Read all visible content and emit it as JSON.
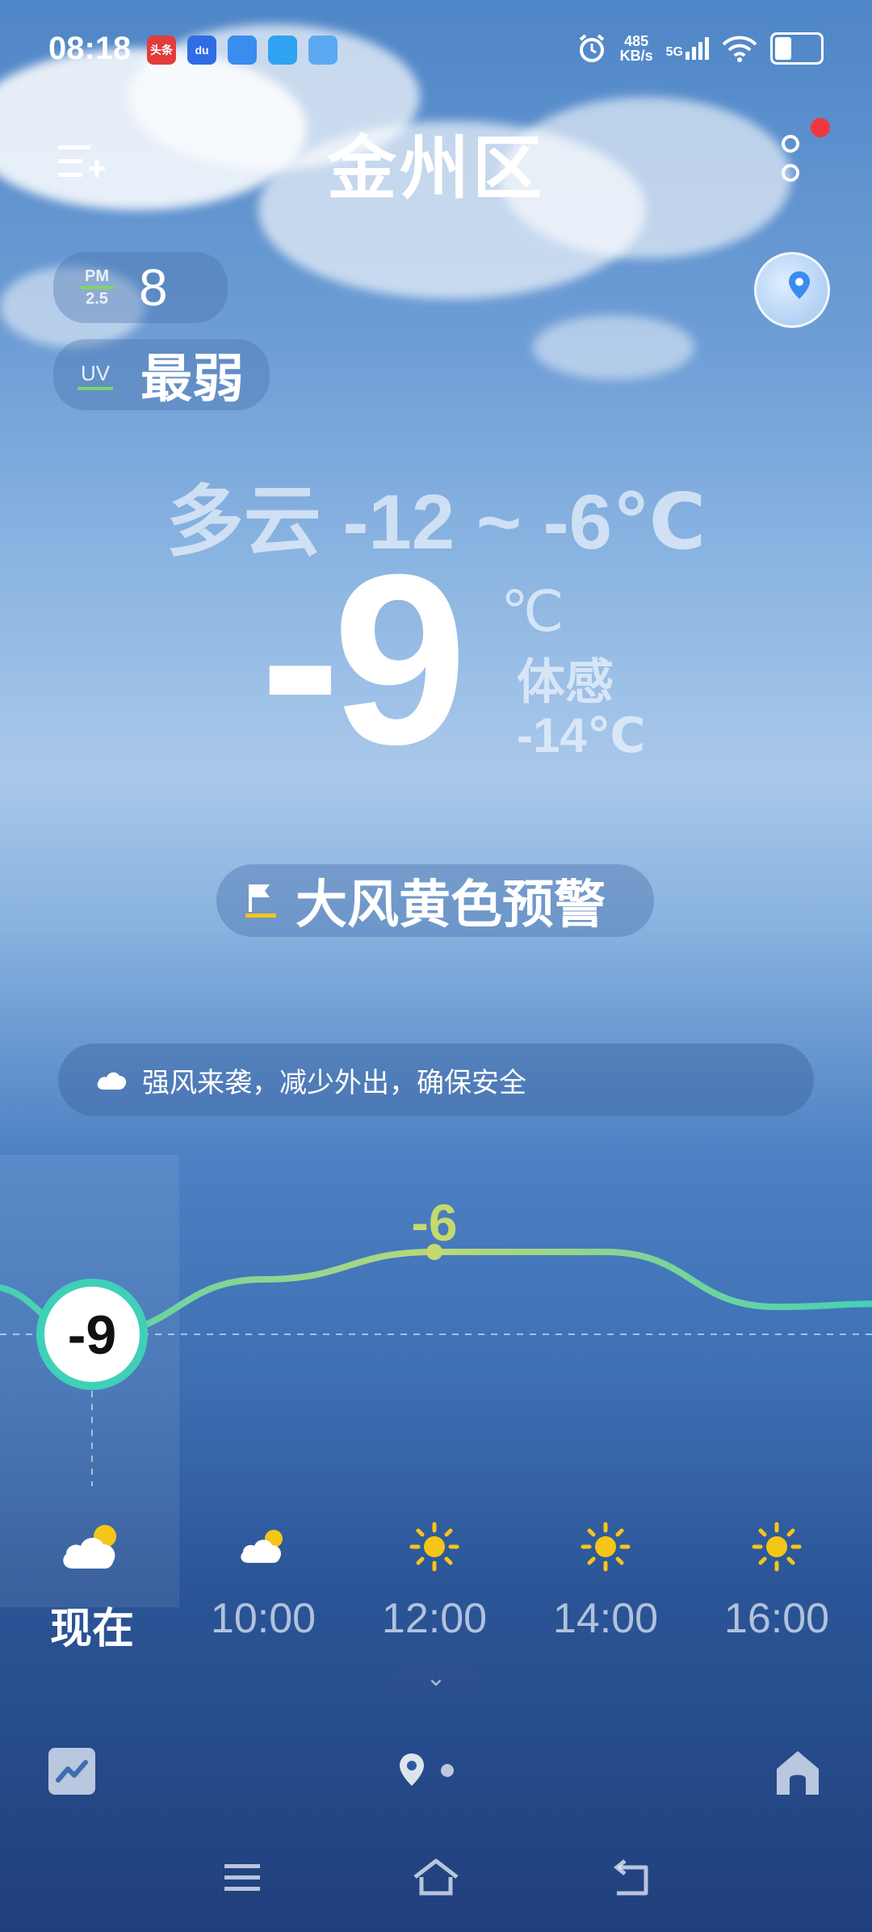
{
  "status_bar": {
    "time": "08:18",
    "apps": [
      "头条",
      "du"
    ],
    "net_speed_value": "485",
    "net_speed_unit": "KB/s",
    "network": "5G"
  },
  "header": {
    "title": "金州区"
  },
  "pm25": {
    "label_top": "PM",
    "label_bottom": "2.5",
    "value": "8"
  },
  "uv": {
    "label": "UV",
    "value": "最弱"
  },
  "current": {
    "condition_range": "多云 -12 ~ -6℃",
    "temp": "-9",
    "unit": "℃",
    "feels_label": "体感",
    "feels_value": "-14℃"
  },
  "alert": {
    "text": "大风黄色预警"
  },
  "tip": {
    "text": "强风来袭，减少外出，确保安全"
  },
  "chart_data": {
    "type": "line",
    "x": [
      "现在",
      "10:00",
      "12:00",
      "14:00",
      "16:00"
    ],
    "series": [
      {
        "values": [
          -9,
          -7,
          -6,
          -6,
          -8
        ]
      }
    ],
    "labels": [
      {
        "x": "现在",
        "text": "-9"
      },
      {
        "x": "12:00",
        "text": "-6"
      }
    ],
    "colors": {
      "line_start": "#3fd0b8",
      "line_end": "#b9d87a",
      "label_peak": "#c6d96c"
    }
  },
  "hourly": [
    {
      "label": "现在",
      "icon": "partly-cloudy-icon"
    },
    {
      "label": "10:00",
      "icon": "partly-cloudy-icon"
    },
    {
      "label": "12:00",
      "icon": "sun-icon"
    },
    {
      "label": "14:00",
      "icon": "sun-icon"
    },
    {
      "label": "16:00",
      "icon": "sun-icon"
    }
  ],
  "expand_symbol": "⌄",
  "colors": {
    "alert_red": "#f0393e",
    "sun": "#f5c518",
    "accent_green": "#7fd46a"
  }
}
